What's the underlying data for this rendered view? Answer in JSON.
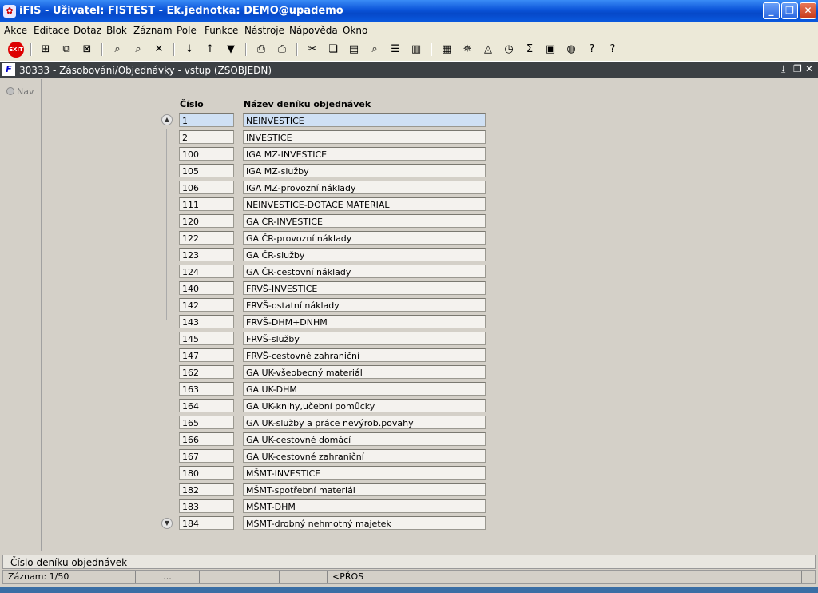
{
  "window": {
    "title": "iFIS - Uživatel: FISTEST - Ek.jednotka: DEMO@upademo",
    "icon": "app-icon"
  },
  "menu": [
    "Akce",
    "Editace",
    "Dotaz",
    "Blok",
    "Záznam",
    "Pole",
    "Funkce",
    "Nástroje",
    "Nápověda",
    "Okno"
  ],
  "toolbar": {
    "exit_label": "EXIT"
  },
  "form": {
    "title": "30333 - Zásobování/Objednávky - vstup (ZSOBJEDN)"
  },
  "nav": {
    "label": "Nav"
  },
  "table": {
    "headers": {
      "cislo": "Číslo",
      "nazev": "Název deníku objednávek"
    },
    "rows": [
      {
        "cislo": "1",
        "nazev": "NEINVESTICE"
      },
      {
        "cislo": "2",
        "nazev": "INVESTICE"
      },
      {
        "cislo": "100",
        "nazev": "IGA MZ-INVESTICE"
      },
      {
        "cislo": "105",
        "nazev": "IGA MZ-služby"
      },
      {
        "cislo": "106",
        "nazev": "IGA MZ-provozní náklady"
      },
      {
        "cislo": "111",
        "nazev": "NEINVESTICE-DOTACE MATERIAL"
      },
      {
        "cislo": "120",
        "nazev": "GA ČR-INVESTICE"
      },
      {
        "cislo": "122",
        "nazev": "GA ČR-provozní náklady"
      },
      {
        "cislo": "123",
        "nazev": "GA ČR-služby"
      },
      {
        "cislo": "124",
        "nazev": "GA ČR-cestovní náklady"
      },
      {
        "cislo": "140",
        "nazev": "FRVŠ-INVESTICE"
      },
      {
        "cislo": "142",
        "nazev": "FRVŠ-ostatní náklady"
      },
      {
        "cislo": "143",
        "nazev": "FRVŠ-DHM+DNHM"
      },
      {
        "cislo": "145",
        "nazev": "FRVŠ-služby"
      },
      {
        "cislo": "147",
        "nazev": "FRVŠ-cestovné zahraniční"
      },
      {
        "cislo": "162",
        "nazev": "GA UK-všeobecný materiál"
      },
      {
        "cislo": "163",
        "nazev": "GA UK-DHM"
      },
      {
        "cislo": "164",
        "nazev": "GA UK-knihy,učební pomůcky"
      },
      {
        "cislo": "165",
        "nazev": "GA UK-služby a práce nevýrob.povahy"
      },
      {
        "cislo": "166",
        "nazev": "GA UK-cestovné domácí"
      },
      {
        "cislo": "167",
        "nazev": "GA UK-cestovné zahraniční"
      },
      {
        "cislo": "180",
        "nazev": "MŠMT-INVESTICE"
      },
      {
        "cislo": "182",
        "nazev": "MŠMT-spotřební materiál"
      },
      {
        "cislo": "183",
        "nazev": "MŠMT-DHM"
      },
      {
        "cislo": "184",
        "nazev": "MŠMT-drobný nehmotný majetek"
      }
    ]
  },
  "hint": "Číslo deníku objednávek",
  "status": {
    "record": "Záznam: 1/50",
    "dots": "...",
    "mode": "<PŘOS"
  }
}
